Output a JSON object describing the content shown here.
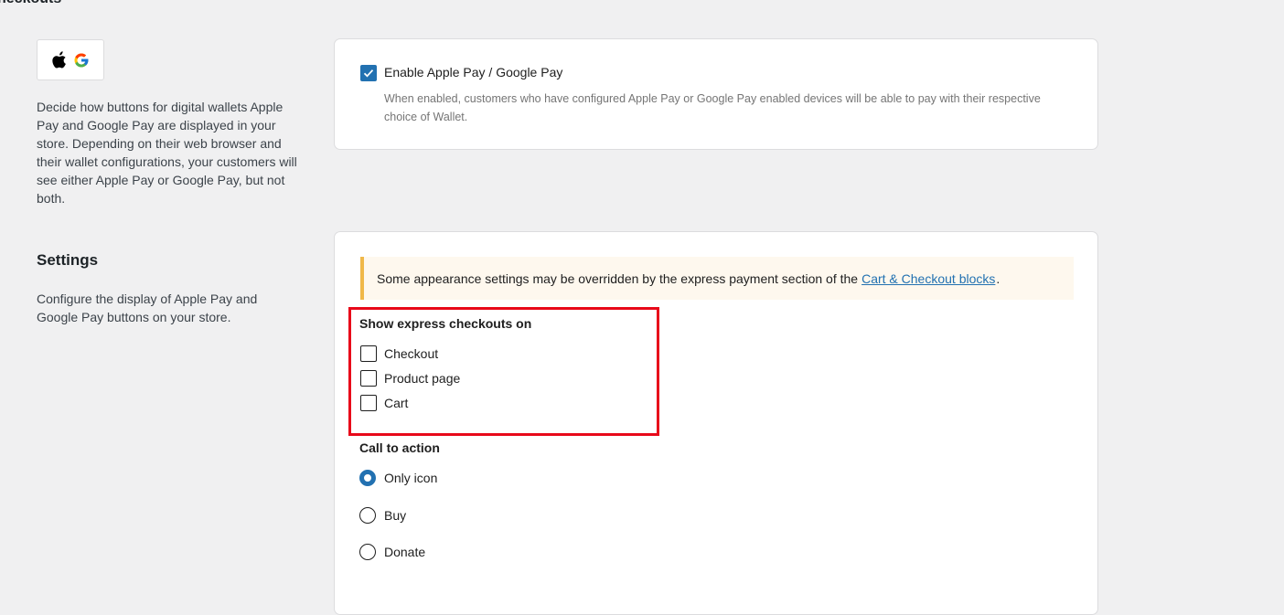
{
  "header": {
    "title": "heckouts"
  },
  "wallets": {
    "logo_icons": [
      "apple-icon",
      "google-g-icon"
    ],
    "description": "Decide how buttons for digital wallets Apple Pay and Google Pay are displayed in your store. Depending on their web browser and their wallet configurations, your customers will see either Apple Pay or Google Pay, but not both.",
    "enable_label": "Enable Apple Pay / Google Pay",
    "enable_checked": true,
    "enable_help": "When enabled, customers who have configured Apple Pay or Google Pay enabled devices will be able to pay with their respective choice of Wallet."
  },
  "settings": {
    "title": "Settings",
    "description": "Configure the display of Apple Pay and Google Pay buttons on your store.",
    "notice": {
      "text_before": "Some appearance settings may be overridden by the express payment section of the",
      "link_text": "Cart & Checkout blocks",
      "text_after": "."
    },
    "show_on": {
      "title": "Show express checkouts on",
      "options": [
        {
          "label": "Checkout",
          "checked": false
        },
        {
          "label": "Product page",
          "checked": false
        },
        {
          "label": "Cart",
          "checked": false
        }
      ]
    },
    "call_to_action": {
      "title": "Call to action",
      "options": [
        {
          "label": "Only icon",
          "selected": true
        },
        {
          "label": "Buy",
          "selected": false
        },
        {
          "label": "Donate",
          "selected": false
        }
      ]
    }
  },
  "colors": {
    "accent": "#2271b1",
    "highlight": "#e8091a",
    "notice_border": "#f0b849",
    "notice_bg": "#fef8ee"
  }
}
